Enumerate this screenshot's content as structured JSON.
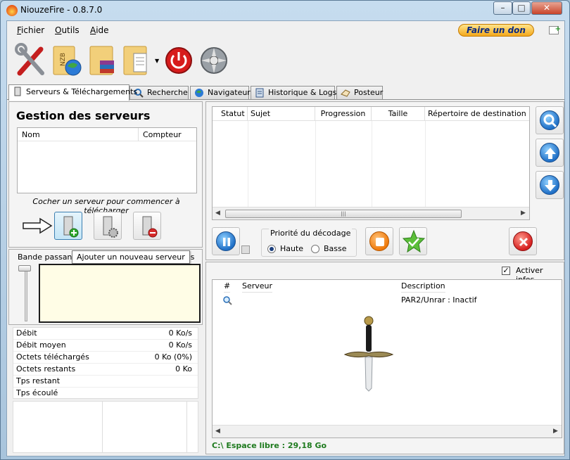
{
  "window": {
    "title": "NiouzeFire - 0.8.7.0"
  },
  "menu": {
    "fichier": "Fichier",
    "outils": "Outils",
    "aide": "Aide",
    "donate": "Faire un don"
  },
  "tabs": [
    {
      "label": "Serveurs & Téléchargements"
    },
    {
      "label": "Recherche"
    },
    {
      "label": "Navigateur"
    },
    {
      "label": "Historique & Logs"
    },
    {
      "label": "Posteur"
    }
  ],
  "servers": {
    "title": "Gestion des serveurs",
    "columns": {
      "nom": "Nom",
      "compteur": "Compteur"
    },
    "hint": "Cocher un serveur pour commencer à télécharger"
  },
  "bandwidth": {
    "label_start": "Bande passante",
    "label_end": "fos"
  },
  "tooltip": "Ajouter un nouveau serveur",
  "stats": [
    {
      "label": "Débit",
      "value": "0 Ko/s"
    },
    {
      "label": "Débit moyen",
      "value": "0 Ko/s"
    },
    {
      "label": "Octets téléchargés",
      "value": "0 Ko (0%)"
    },
    {
      "label": "Octets restants",
      "value": "0 Ko"
    },
    {
      "label": "Tps restant",
      "value": ""
    },
    {
      "label": "Tps écoulé",
      "value": ""
    }
  ],
  "downloads": {
    "columns": {
      "statut": "Statut",
      "sujet": "Sujet",
      "progression": "Progression",
      "taille": "Taille",
      "repertoire": "Répertoire de destination"
    }
  },
  "priority": {
    "label": "Priorité du décodage",
    "haute": "Haute",
    "basse": "Basse",
    "selected": "Haute"
  },
  "info": {
    "activer_label": "Activer infos",
    "activer_checked": true,
    "columns": {
      "num": "#",
      "serveur": "Serveur",
      "description": "Description"
    },
    "rows": [
      {
        "description": "PAR2/Unrar : Inactif"
      }
    ]
  },
  "status": {
    "disk": "C:\\ Espace libre : 29,18 Go"
  },
  "colors": {
    "accent": "#1f6fc6",
    "donate": "#f3a81c",
    "disk_status": "#1e7a1e"
  }
}
